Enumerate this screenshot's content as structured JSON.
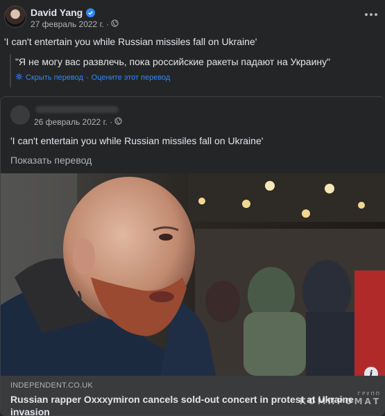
{
  "post": {
    "author": "David Yang",
    "date": "27 февраль 2022 г. ·",
    "text": "'I can't entertain you while Russian missiles fall on Ukraine'",
    "translation": {
      "text": "\"Я не могу вас развлечь, пока российские ракеты падают на Украину\"",
      "hide_label": "Скрыть перевод",
      "separator": "·",
      "rate_label": "Оцените этот перевод"
    }
  },
  "shared_post": {
    "date": "26 февраль 2022 г. ·",
    "text": "'I can't entertain you while Russian missiles fall on Ukraine'",
    "translate_label": "Показать перевод",
    "link": {
      "domain": "INDEPENDENT.CO.UK",
      "title": "Russian rapper Oxxxymiron cancels sold-out concert in protest at Ukraine invasion"
    }
  },
  "watermark": {
    "small": "ГРУПП",
    "big": "КОМПРОМАТ"
  },
  "colors": {
    "background": "#242526",
    "text": "#e4e6eb",
    "secondary": "#b0b3b8",
    "link": "#2d88ff",
    "verified": "#2d88ff"
  }
}
